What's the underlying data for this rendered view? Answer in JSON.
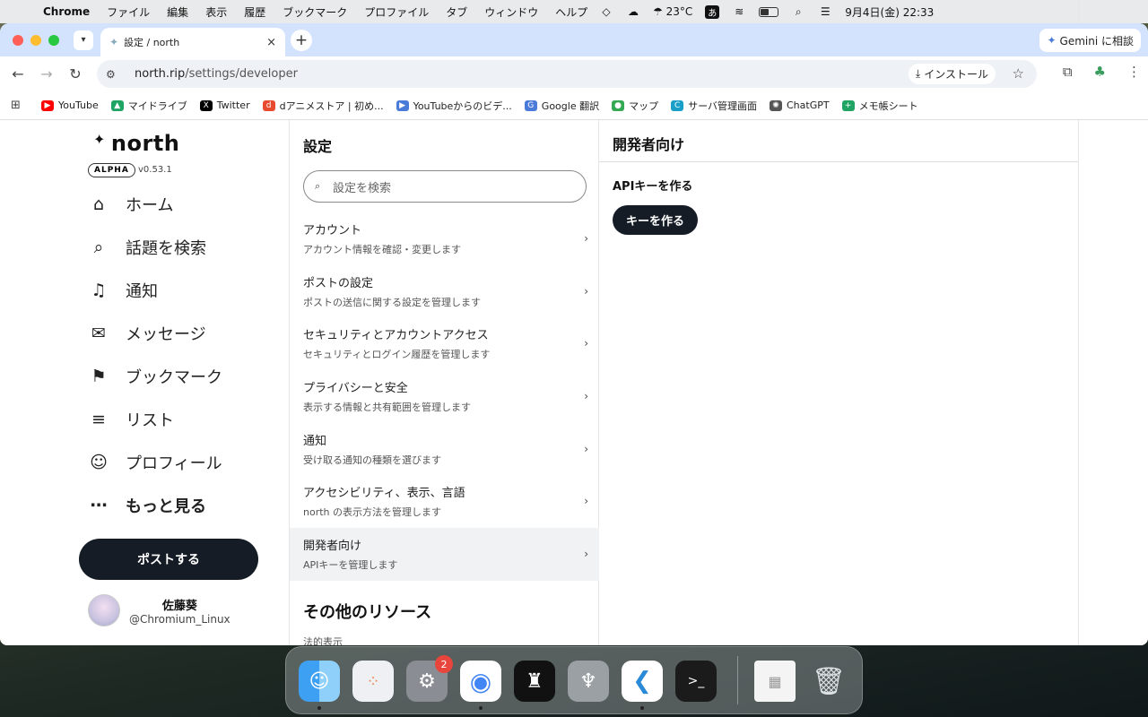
{
  "menubar": {
    "app": "Chrome",
    "items": [
      "ファイル",
      "編集",
      "表示",
      "履歴",
      "ブックマーク",
      "プロファイル",
      "タブ",
      "ウィンドウ",
      "ヘルプ"
    ],
    "weather": "23°C",
    "input_mode": "あ",
    "datetime": "9月4日(金) 22:33"
  },
  "browser": {
    "tab_title": "設定 / north",
    "gemini_label": "Gemini に相談",
    "url_host": "north.rip",
    "url_path": "/settings/developer",
    "install_label": "インストール",
    "bookmarks": [
      {
        "label": "YouTube",
        "color": "#ff0000"
      },
      {
        "label": "マイドライブ",
        "color": "#1fa463"
      },
      {
        "label": "Twitter",
        "color": "#000000"
      },
      {
        "label": "dアニメストア | 初め...",
        "color": "#e84a2f"
      },
      {
        "label": "YouTubeからのビデ...",
        "color": "#4a7bd8"
      },
      {
        "label": "Google 翻訳",
        "color": "#4a7bd8"
      },
      {
        "label": "マップ",
        "color": "#34a853"
      },
      {
        "label": "サーバ管理画面",
        "color": "#1aa0c8"
      },
      {
        "label": "ChatGPT",
        "color": "#555555"
      },
      {
        "label": "メモ帳シート",
        "color": "#1fa463"
      }
    ]
  },
  "sidebar": {
    "logo": "north",
    "badge": "ALPHA",
    "version": "v0.53.1",
    "nav": [
      {
        "label": "ホーム",
        "icon": "home-icon"
      },
      {
        "label": "話題を検索",
        "icon": "search-icon"
      },
      {
        "label": "通知",
        "icon": "bell-icon"
      },
      {
        "label": "メッセージ",
        "icon": "mail-icon"
      },
      {
        "label": "ブックマーク",
        "icon": "bookmark-icon"
      },
      {
        "label": "リスト",
        "icon": "list-icon"
      },
      {
        "label": "プロフィール",
        "icon": "person-icon"
      },
      {
        "label": "もっと見る",
        "icon": "more-icon"
      }
    ],
    "post_button": "ポストする",
    "user_name": "佐藤葵",
    "user_handle": "@Chromium_Linux"
  },
  "settings": {
    "title": "設定",
    "search_placeholder": "設定を検索",
    "items": [
      {
        "title": "アカウント",
        "desc": "アカウント情報を確認・変更します"
      },
      {
        "title": "ポストの設定",
        "desc": "ポストの送信に関する設定を管理します"
      },
      {
        "title": "セキュリティとアカウントアクセス",
        "desc": "セキュリティとログイン履歴を管理します"
      },
      {
        "title": "プライバシーと安全",
        "desc": "表示する情報と共有範囲を管理します"
      },
      {
        "title": "通知",
        "desc": "受け取る通知の種類を選びます"
      },
      {
        "title": "アクセシビリティ、表示、言語",
        "desc": "north の表示方法を管理します"
      },
      {
        "title": "開発者向け",
        "desc": "APIキーを管理します"
      }
    ],
    "other_title": "その他のリソース",
    "legal": "法的表示"
  },
  "developer": {
    "title": "開発者向け",
    "subtitle": "APIキーを作る",
    "button": "キーを作る"
  },
  "dock": {
    "settings_badge": "2"
  }
}
